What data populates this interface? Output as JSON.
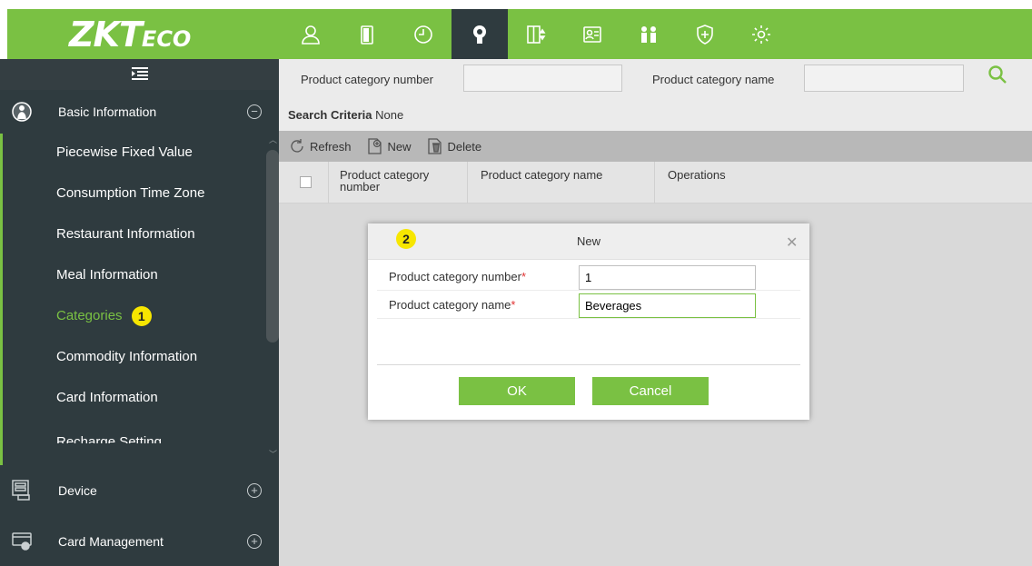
{
  "brand": {
    "logo_main": "ZKT",
    "logo_sub": "ECO",
    "color": "#7ac143"
  },
  "modules": [
    {
      "icon": "person-icon"
    },
    {
      "icon": "door-icon"
    },
    {
      "icon": "clock-icon"
    },
    {
      "icon": "consumption-icon",
      "active": true
    },
    {
      "icon": "elevator-icon"
    },
    {
      "icon": "visitor-icon"
    },
    {
      "icon": "patrol-icon"
    },
    {
      "icon": "security-icon"
    },
    {
      "icon": "settings-icon"
    }
  ],
  "sidebar": {
    "basic_information": "Basic Information",
    "items": [
      "Piecewise Fixed Value",
      "Consumption Time Zone",
      "Restaurant Information",
      "Meal Information",
      "Categories",
      "Commodity Information",
      "Card Information",
      "Recharge Setting"
    ],
    "active_item": "Categories",
    "active_badge": "1",
    "device": "Device",
    "card_management": "Card Management"
  },
  "filter": {
    "number_label": "Product category number",
    "name_label": "Product category name"
  },
  "criteria": {
    "label": "Search Criteria",
    "value": "None"
  },
  "toolbar": {
    "refresh": "Refresh",
    "new": "New",
    "delete": "Delete"
  },
  "grid": {
    "columns": [
      "Product category number",
      "Product category name",
      "Operations"
    ]
  },
  "dialog": {
    "badge": "2",
    "title": "New",
    "number_label": "Product category number",
    "number_value": "1",
    "name_label": "Product category name",
    "name_value": "Beverages",
    "required_mark": "*",
    "ok": "OK",
    "cancel": "Cancel"
  }
}
